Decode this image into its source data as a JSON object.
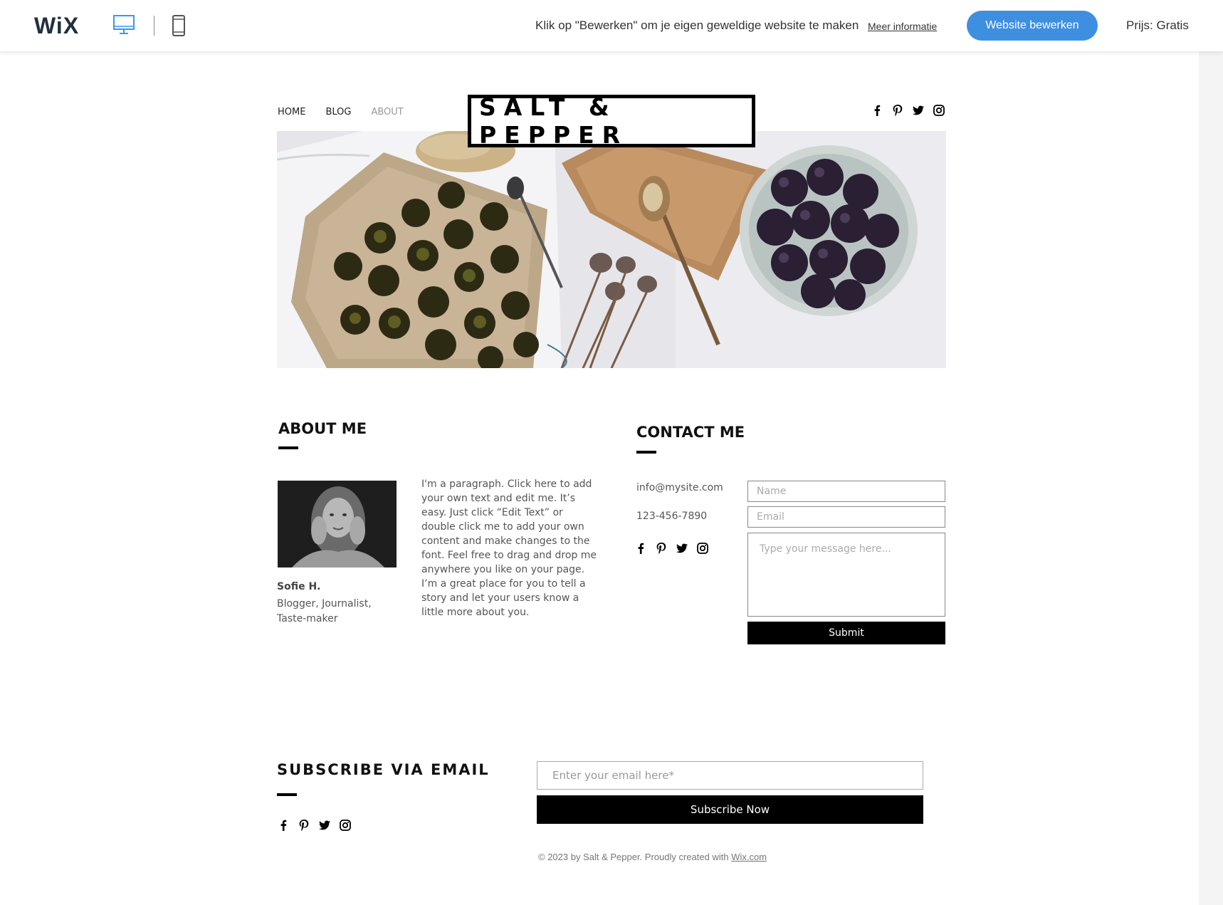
{
  "wixbar": {
    "logo": "WiX",
    "message": "Klik op \"Bewerken\" om je eigen geweldige website te maken",
    "more_info": "Meer informatie",
    "edit_button": "Website bewerken",
    "price": "Prijs: Gratis",
    "accent_color": "#3f8fe0"
  },
  "nav": {
    "items": [
      {
        "label": "HOME"
      },
      {
        "label": "BLOG"
      },
      {
        "label": "ABOUT"
      }
    ]
  },
  "brand": "SALT & PEPPER",
  "social_icons": [
    "facebook-icon",
    "pinterest-icon",
    "twitter-icon",
    "instagram-icon"
  ],
  "about": {
    "title": "ABOUT ME",
    "name": "Sofie H.",
    "role": "Blogger, Journalist, Taste-maker",
    "paragraph": "I'm a paragraph. Click here to add your own text and edit me. It’s easy. Just click “Edit Text” or double click me to add your own content and make changes to the font. Feel free to drag and drop me anywhere you like on your page. I’m a great place for you to tell a story and let your users know a little more about you."
  },
  "contact": {
    "title": "CONTACT ME",
    "email": "info@mysite.com",
    "phone": "123-456-7890",
    "name_placeholder": "Name",
    "email_placeholder": "Email",
    "message_placeholder": "Type your message here...",
    "submit": "Submit"
  },
  "subscribe": {
    "title": "SUBSCRIBE VIA EMAIL",
    "email_placeholder": "Enter your email here*",
    "button": "Subscribe Now"
  },
  "footer": {
    "text": "© 2023 by Salt & Pepper. Proudly created with ",
    "link": "Wix.com"
  }
}
